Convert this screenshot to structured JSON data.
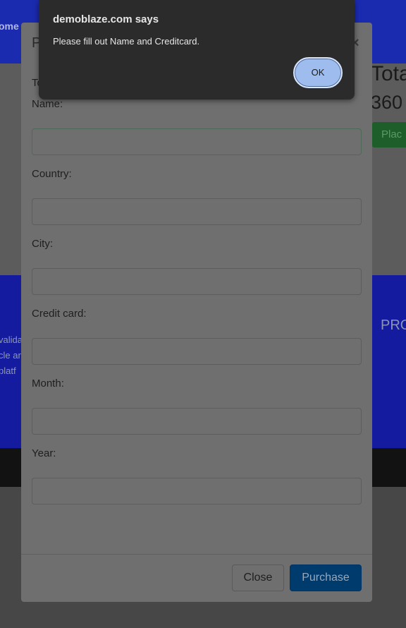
{
  "background": {
    "nav_text": "ome",
    "total_label": "Tota",
    "total_value": "360",
    "place_order_label": "Plac",
    "footer_text_lines": [
      "valida",
      "cle ar",
      "platf"
    ],
    "footer_heading": "PRO"
  },
  "modal": {
    "title": "P",
    "close_icon": "×",
    "total_hint": "To",
    "fields": [
      {
        "label": "Name:",
        "value": ""
      },
      {
        "label": "Country:",
        "value": ""
      },
      {
        "label": "City:",
        "value": ""
      },
      {
        "label": "Credit card:",
        "value": ""
      },
      {
        "label": "Month:",
        "value": ""
      },
      {
        "label": "Year:",
        "value": ""
      }
    ],
    "close_button": "Close",
    "purchase_button": "Purchase"
  },
  "alert": {
    "title": "demoblaze.com says",
    "message": "Please fill out Name and Creditcard.",
    "ok_button": "OK"
  }
}
